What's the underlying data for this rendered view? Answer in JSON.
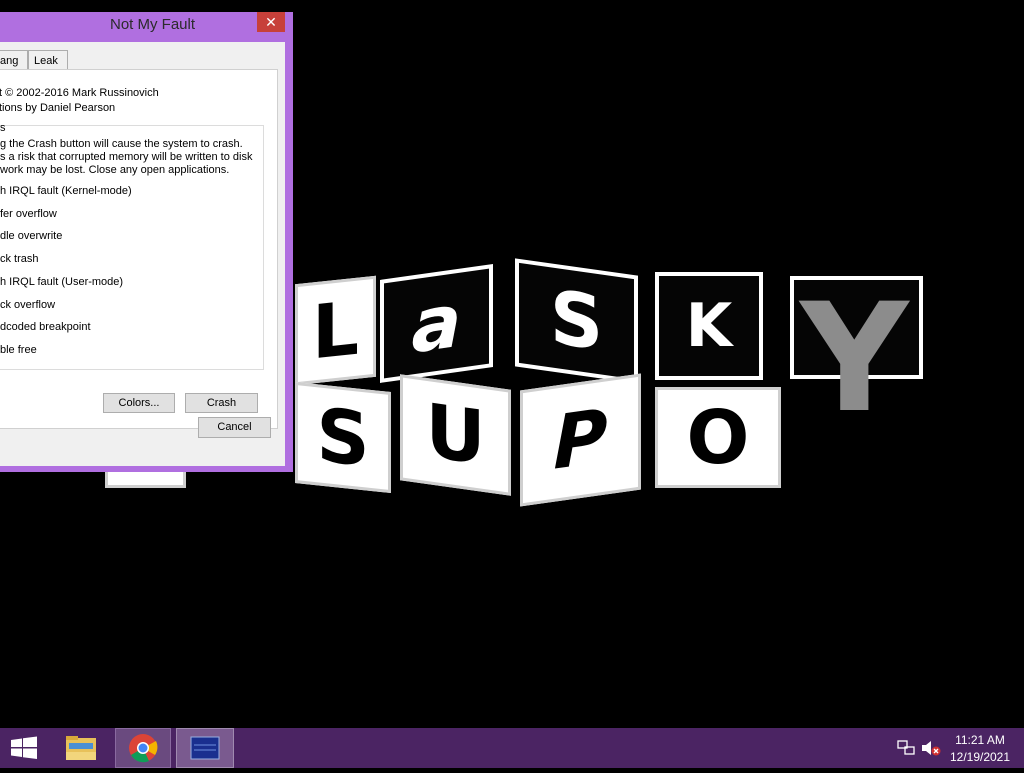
{
  "dialog": {
    "title": "Not My Fault",
    "close_glyph": "✕",
    "tabs": [
      "ang",
      "Leak"
    ],
    "copyright": "t © 2002-2016 Mark Russinovich",
    "credit": "tions by Daniel Pearson",
    "group_label": "s",
    "warning_lines": [
      "g the Crash button will cause the system to crash.",
      "s a risk that corrupted memory will be written to disk",
      "work may be lost. Close any open applications."
    ],
    "options": [
      "h IRQL fault (Kernel-mode)",
      "fer overflow",
      "dle overwrite",
      "ck trash",
      "h IRQL fault (User-mode)",
      "ck overflow",
      "dcoded breakpoint",
      "ble free"
    ],
    "colors_button": "Colors...",
    "crash_button": "Crash",
    "cancel_button": "Cancel"
  },
  "desktop": {
    "logo_top_letters": [
      "L",
      "a",
      "S",
      "K",
      "Y"
    ],
    "logo_bottom_letters": [
      "S",
      "U",
      "P",
      "O"
    ]
  },
  "taskbar": {
    "time": "11:21 AM",
    "date": "12/19/2021",
    "apps": [
      "start-icon",
      "file-explorer-icon",
      "chrome-icon",
      "window-app-icon"
    ],
    "accent_color": "#4b2463"
  }
}
